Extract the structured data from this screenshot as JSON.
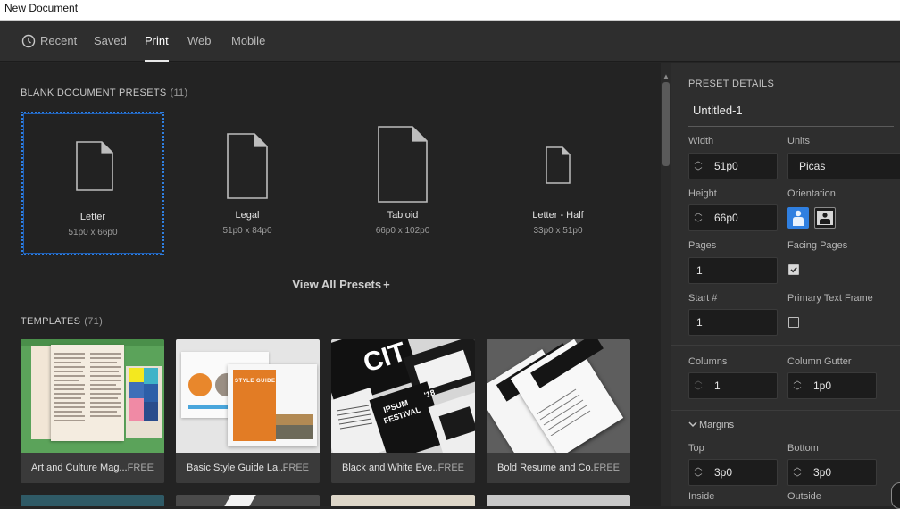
{
  "window": {
    "title": "New Document"
  },
  "tabs": [
    {
      "label": "Recent"
    },
    {
      "label": "Saved"
    },
    {
      "label": "Print"
    },
    {
      "label": "Web"
    },
    {
      "label": "Mobile"
    }
  ],
  "active_tab": "Print",
  "presets_section": {
    "title": "BLANK DOCUMENT PRESETS",
    "count": "(11)"
  },
  "presets": [
    {
      "name": "Letter",
      "dims": "51p0 x 66p0",
      "selected": true
    },
    {
      "name": "Legal",
      "dims": "51p0 x 84p0",
      "selected": false
    },
    {
      "name": "Tabloid",
      "dims": "66p0 x 102p0",
      "selected": false
    },
    {
      "name": "Letter - Half",
      "dims": "33p0 x 51p0",
      "selected": false
    }
  ],
  "view_all": "View All Presets",
  "view_all_icon": "+",
  "templates_section": {
    "title": "TEMPLATES",
    "count": "(71)"
  },
  "templates": [
    {
      "name": "Art and Culture Mag...",
      "badge": "FREE"
    },
    {
      "name": "Basic Style Guide La...",
      "badge": "FREE"
    },
    {
      "name": "Black and White Eve...",
      "badge": "FREE"
    },
    {
      "name": "Bold Resume and Co...",
      "badge": "FREE"
    }
  ],
  "template_thumb_text": {
    "style_guide": "STYLE GUIDE",
    "cit": "CIT",
    "ipsum": "IPSUM",
    "festival": "FESTIVAL",
    "year": "'18"
  },
  "details": {
    "heading": "PRESET DETAILS",
    "doc_name": "Untitled-1",
    "width_label": "Width",
    "width_value": "51p0",
    "units_label": "Units",
    "units_value": "Picas",
    "height_label": "Height",
    "height_value": "66p0",
    "orientation_label": "Orientation",
    "pages_label": "Pages",
    "pages_value": "1",
    "facing_label": "Facing Pages",
    "facing_checked": true,
    "start_label": "Start #",
    "start_value": "1",
    "primary_label": "Primary Text Frame",
    "primary_checked": false,
    "columns_label": "Columns",
    "columns_value": "1",
    "gutter_label": "Column Gutter",
    "gutter_value": "1p0",
    "margins_label": "Margins",
    "top_label": "Top",
    "top_value": "3p0",
    "bottom_label": "Bottom",
    "bottom_value": "3p0",
    "inside_label": "Inside",
    "outside_label": "Outside"
  },
  "colors": {
    "accent": "#2f7fe0",
    "background": "#232323",
    "panel": "#2e2e2e"
  }
}
